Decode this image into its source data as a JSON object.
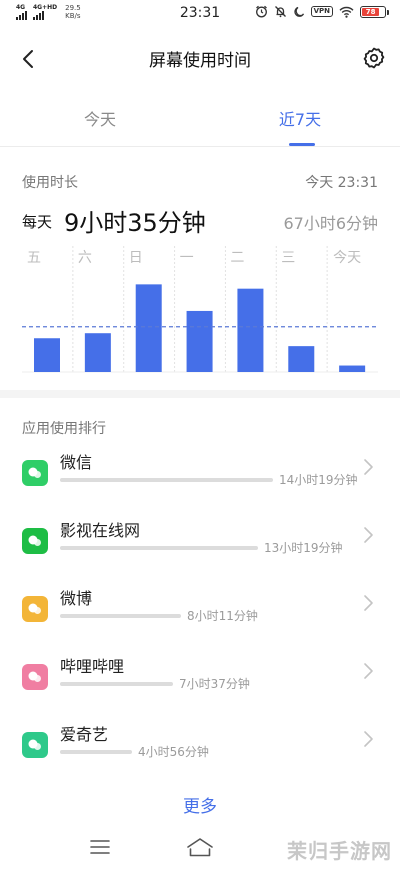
{
  "status_bar": {
    "signal1_label": "4G",
    "signal2_label": "4G+HD",
    "net_speed_value": "29.5",
    "net_speed_unit": "KB/s",
    "time": "23:31",
    "vpn": "VPN",
    "battery": "78",
    "battery_level": 0.78,
    "battery_color": "#e8443a"
  },
  "header": {
    "title": "屏幕使用时间"
  },
  "tabs": [
    {
      "label": "今天",
      "active": false
    },
    {
      "label": "近7天",
      "active": true
    }
  ],
  "usage": {
    "label": "使用时长",
    "timestamp": "今天 23:31",
    "daily_prefix": "每天",
    "daily_value": "9小时35分钟",
    "total": "67小时6分钟"
  },
  "chart_data": {
    "type": "bar",
    "categories": [
      "五",
      "六",
      "日",
      "一",
      "二",
      "三",
      "今天"
    ],
    "values": [
      4.7,
      5.4,
      12.2,
      8.5,
      11.6,
      3.6,
      0.9
    ],
    "average": 6.3,
    "ylim": [
      0,
      14.2
    ],
    "title": "",
    "xlabel": "",
    "ylabel": "",
    "grid": "vertical dotted separators",
    "bar_color": "#456fe8",
    "average_line_color": "#5b79d6"
  },
  "ranking": {
    "title": "应用使用排行",
    "apps": [
      {
        "name": "微信",
        "duration": "14小时19分钟",
        "share": 1.0,
        "icon": "wechat-icon",
        "color": "#2fce67"
      },
      {
        "name": "影视在线网",
        "duration": "13小时19分钟",
        "share": 0.93,
        "icon": "video-app-icon",
        "color": "#1ebd45"
      },
      {
        "name": "微博",
        "duration": "8小时11分钟",
        "share": 0.57,
        "icon": "weibo-icon",
        "color": "#f3b538"
      },
      {
        "name": "哔哩哔哩",
        "duration": "7小时37分钟",
        "share": 0.53,
        "icon": "bilibili-icon",
        "color": "#f07ea2"
      },
      {
        "name": "爱奇艺",
        "duration": "4小时56分钟",
        "share": 0.34,
        "icon": "iqiyi-icon",
        "color": "#2ec98a"
      }
    ],
    "more_label": "更多"
  },
  "icons": {
    "back": "back-arrow-icon",
    "settings": "gear-icon",
    "chevron": "chevron-right-icon",
    "nav_menu": "menu-icon",
    "nav_home": "home-icon"
  },
  "accent_color": "#456fe8",
  "watermark": "茉归手游网"
}
